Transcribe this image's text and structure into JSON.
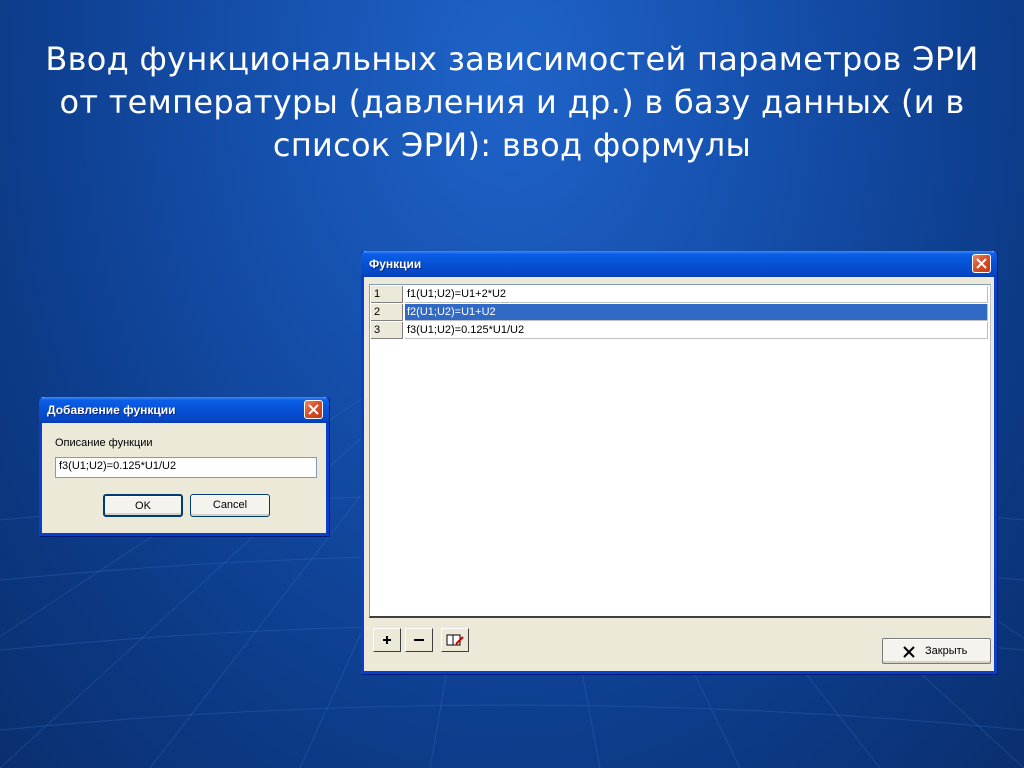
{
  "slide": {
    "title_lines": [
      "Ввод функциональных зависимостей параметров ЭРИ",
      "от температуры (давления и др.) в базу данных (и в",
      "список ЭРИ): ввод формулы"
    ]
  },
  "add_function_dialog": {
    "title": "Добавление функции",
    "description_label": "Описание функции",
    "formula_value": "f3(U1;U2)=0.125*U1/U2",
    "ok_label": "OK",
    "cancel_label": "Cancel"
  },
  "functions_window": {
    "title": "Функции",
    "rows": [
      {
        "num": "1",
        "formula": "f1(U1;U2)=U1+2*U2",
        "selected": false
      },
      {
        "num": "2",
        "formula": "f2(U1;U2)=U1+U2",
        "selected": true
      },
      {
        "num": "3",
        "formula": "f3(U1;U2)=0.125*U1/U2",
        "selected": false
      }
    ],
    "toolbar": {
      "add_icon": "plus-icon",
      "remove_icon": "minus-icon",
      "edit_icon": "book-edit-icon"
    },
    "close_label": "Закрыть",
    "close_icon": "x-icon"
  },
  "colors": {
    "background": "#1550ad",
    "titlebar": "#0651d6",
    "selection": "#316ac5"
  }
}
